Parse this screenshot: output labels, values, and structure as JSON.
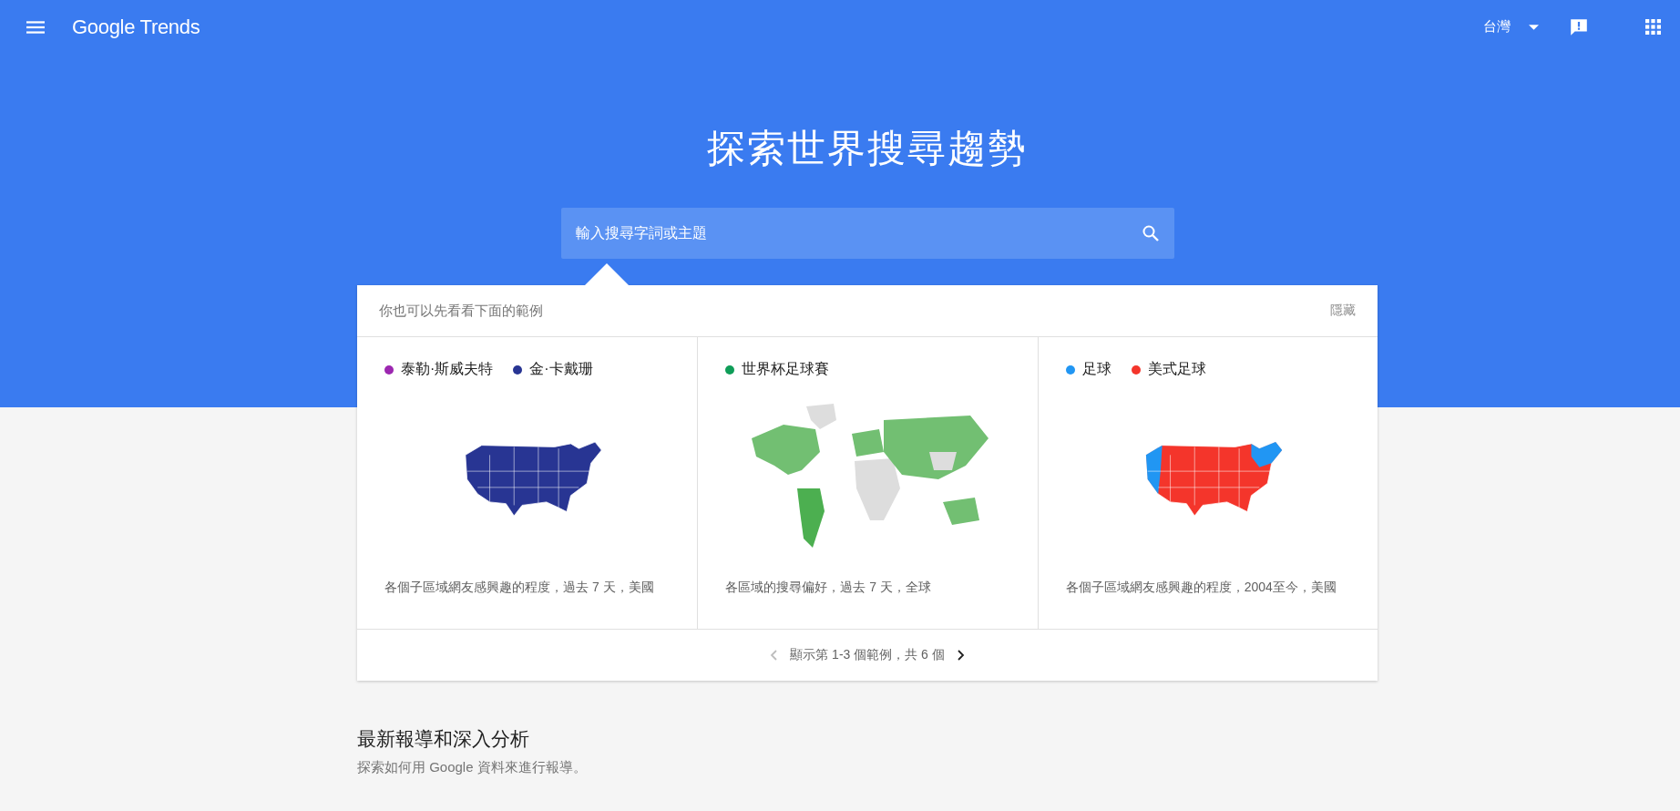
{
  "header": {
    "logo": "Google Trends",
    "region": "台灣"
  },
  "hero": {
    "title": "探索世界搜尋趨勢",
    "search": {
      "placeholder": "輸入搜尋字詞或主題"
    }
  },
  "examples": {
    "intro": "你也可以先看看下面的範例",
    "hide": "隱藏",
    "cards": [
      {
        "kind": "us",
        "terms": [
          {
            "label": "泰勒·斯威夫特",
            "color": "#9c27b0"
          },
          {
            "label": "金·卡戴珊",
            "color": "#283593"
          }
        ],
        "caption": "各個子區域網友感興趣的程度，過去 7 天，美國"
      },
      {
        "kind": "world",
        "terms": [
          {
            "label": "世界杯足球賽",
            "color": "#0f9d58"
          }
        ],
        "caption": "各區域的搜尋偏好，過去 7 天，全球"
      },
      {
        "kind": "us_split",
        "terms": [
          {
            "label": "足球",
            "color": "#2196f3"
          },
          {
            "label": "美式足球",
            "color": "#f4352b"
          }
        ],
        "caption": "各個子區域網友感興趣的程度，2004至今，美國"
      }
    ],
    "pager": {
      "text": "顯示第 1-3 個範例，共 6 個",
      "prev_disabled": true,
      "next_disabled": false
    }
  },
  "stories": {
    "title": "最新報導和深入分析",
    "subtitle": "探索如何用 Google 資料來進行報導。"
  }
}
